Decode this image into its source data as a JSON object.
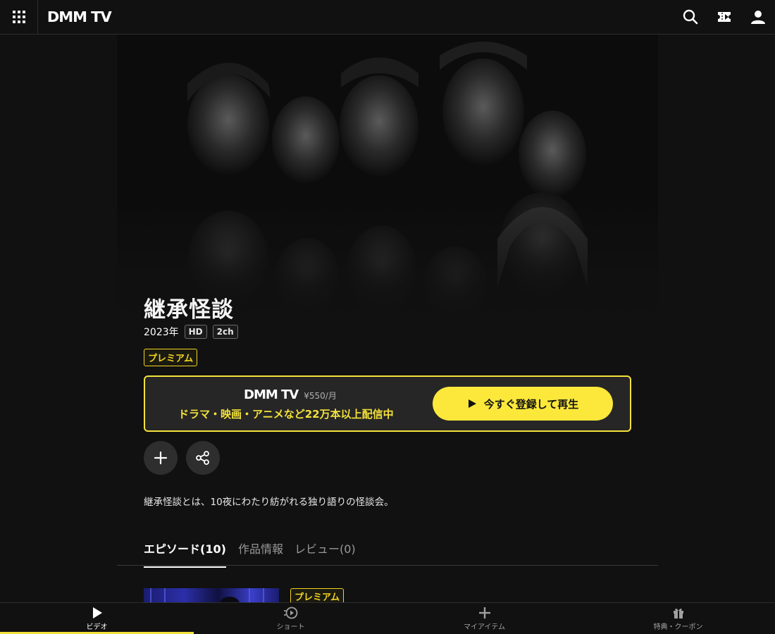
{
  "header": {
    "logo": "DMM TV",
    "icons": [
      "grid-menu-icon",
      "search-icon",
      "ticket-icon",
      "user-icon"
    ]
  },
  "title": {
    "main": "継承怪談",
    "year": "2023年",
    "tags": [
      "HD",
      "2ch"
    ],
    "badge": "プレミアム"
  },
  "promo": {
    "brand": "DMM TV",
    "price": "¥550/月",
    "tagline": "ドラマ・映画・アニメなど22万本以上配信中",
    "cta": "今すぐ登録して再生"
  },
  "actions": {
    "add_icon": "plus-icon",
    "share_icon": "share-icon"
  },
  "description": "継承怪談とは、10夜にわたり紡がれる独り語りの怪談会。",
  "tabs": [
    {
      "label": "エピソード(10)",
      "active": true
    },
    {
      "label": "作品情報",
      "active": false
    },
    {
      "label": "レビュー(0)",
      "active": false
    }
  ],
  "episode": {
    "badge": "プレミアム"
  },
  "bottom_nav": [
    {
      "label": "ビデオ",
      "icon": "play-icon",
      "active": true
    },
    {
      "label": "ショート",
      "icon": "short-play-icon",
      "active": false
    },
    {
      "label": "マイアイテム",
      "icon": "plus-icon",
      "active": false
    },
    {
      "label": "特典・クーポン",
      "icon": "gift-icon",
      "active": false
    }
  ],
  "colors": {
    "accent": "#f4e23a",
    "background": "#111111",
    "button_bg": "#2e2e2e"
  }
}
